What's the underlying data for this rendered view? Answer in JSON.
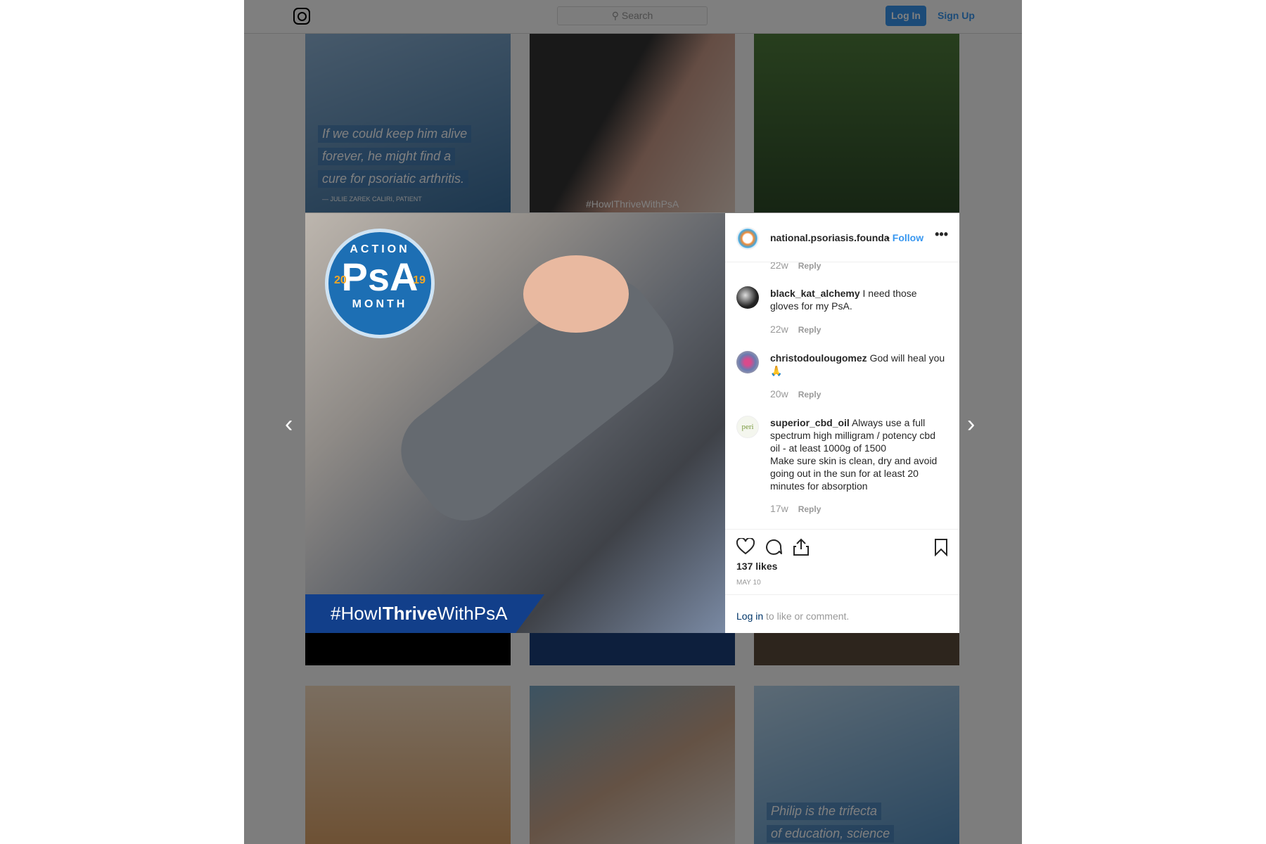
{
  "header": {
    "search_placeholder": "Search",
    "login_label": "Log In",
    "signup_label": "Sign Up"
  },
  "grid": {
    "quote_top": [
      "If we could keep him alive",
      "forever, he might find a",
      "cure for psoriatic arthritis."
    ],
    "quote_top_credit": "— JULIE ZAREK CALIRI, PATIENT",
    "tile2_hashtag": "#HowIThriveWithPsA",
    "quote_bottom": [
      "Philip is the trifecta",
      "of education, science"
    ]
  },
  "post": {
    "badge": {
      "top": "ACTION",
      "main": "PsA",
      "year_left": "20",
      "year_right": "19",
      "bottom": "MONTH"
    },
    "banner_pre": "#HowI",
    "banner_bold": "Thrive",
    "banner_post": "WithPsA",
    "author": "national.psoriasis.founda",
    "follow": "Follow",
    "more": "•••",
    "partial_meta": {
      "age": "22w",
      "reply": "Reply"
    },
    "comments": [
      {
        "user": "black_kat_alchemy",
        "text": "I need those gloves for my PsA.",
        "age": "22w",
        "reply": "Reply"
      },
      {
        "user": "christodoulougomez",
        "text": "God will heal you 🙏",
        "age": "20w",
        "reply": "Reply"
      },
      {
        "user": "superior_cbd_oil",
        "text": "Always use a full spectrum high milligram / potency cbd oil - at least 1000g of 1500",
        "text2": "Make sure skin is clean, dry and avoid going out in the sun for at least 20 minutes for absorption",
        "age": "17w",
        "reply": "Reply"
      }
    ],
    "likes": "137 likes",
    "date": "MAY 10",
    "login_link": "Log in",
    "login_rest": " to like or comment."
  }
}
